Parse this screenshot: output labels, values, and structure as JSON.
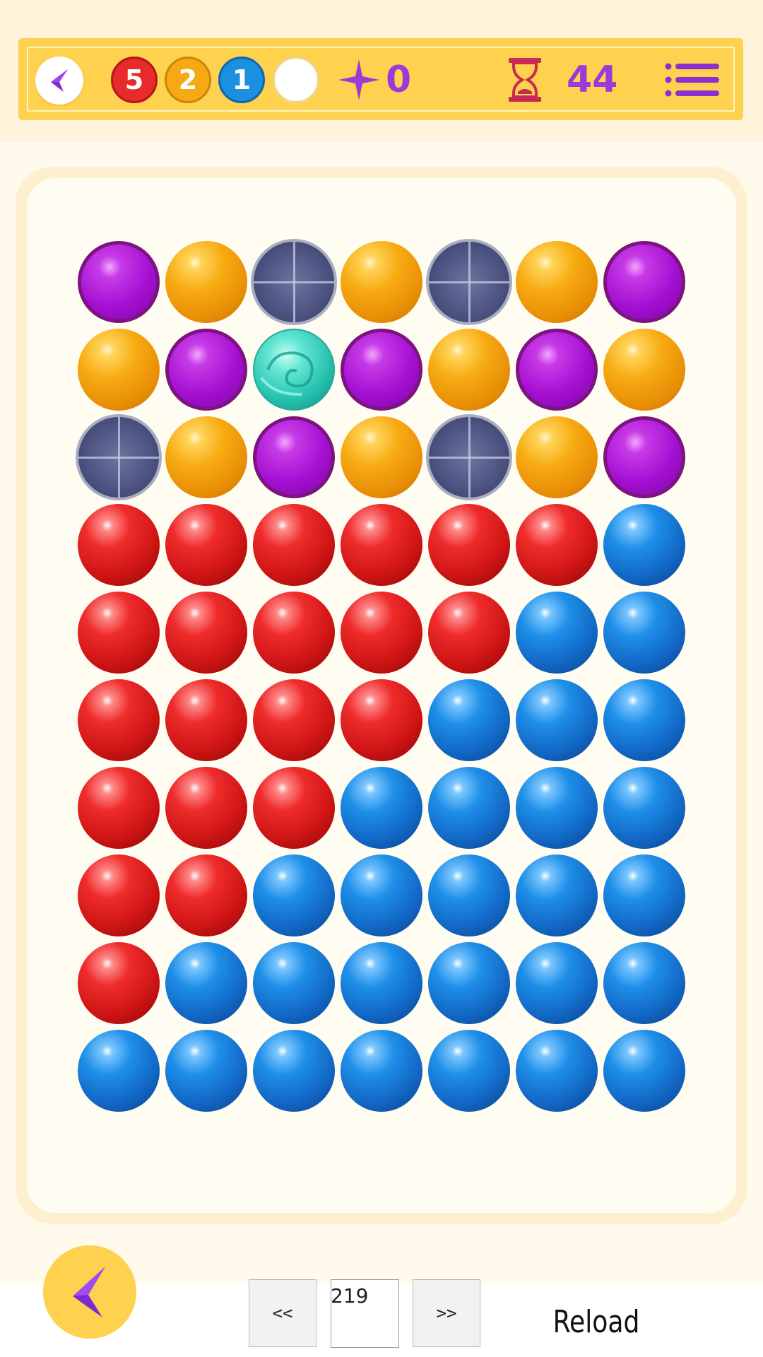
{
  "hud": {
    "back_icon": "chevron-left-icon",
    "counters": [
      {
        "color": "red",
        "value": "5"
      },
      {
        "color": "orange",
        "value": "2"
      },
      {
        "color": "blue",
        "value": "1"
      },
      {
        "color": "white",
        "value": ""
      }
    ],
    "stars": "0",
    "timer_icon": "hourglass-icon",
    "timer": "44",
    "menu_icon": "menu-icon"
  },
  "board": {
    "rows": 10,
    "cols": 7,
    "grid": [
      [
        "purple",
        "orange",
        "block",
        "orange",
        "block",
        "orange",
        "purple"
      ],
      [
        "orange",
        "purple",
        "teal",
        "purple",
        "orange",
        "purple",
        "orange"
      ],
      [
        "block",
        "orange",
        "purple",
        "orange",
        "block",
        "orange",
        "purple"
      ],
      [
        "red",
        "red",
        "red",
        "red",
        "red",
        "red",
        "blue"
      ],
      [
        "red",
        "red",
        "red",
        "red",
        "red",
        "blue",
        "blue"
      ],
      [
        "red",
        "red",
        "red",
        "red",
        "blue",
        "blue",
        "blue"
      ],
      [
        "red",
        "red",
        "red",
        "blue",
        "blue",
        "blue",
        "blue"
      ],
      [
        "red",
        "red",
        "blue",
        "blue",
        "blue",
        "blue",
        "blue"
      ],
      [
        "red",
        "blue",
        "blue",
        "blue",
        "blue",
        "blue",
        "blue"
      ],
      [
        "blue",
        "blue",
        "blue",
        "blue",
        "blue",
        "blue",
        "blue"
      ]
    ]
  },
  "footer": {
    "back_icon": "chevron-left-icon",
    "prev_label": "<<",
    "level_value": "219",
    "next_label": ">>",
    "reload_label": "Reload"
  },
  "colors": {
    "accent_yellow": "#fed14f",
    "counter_purple": "#9b3ad8",
    "background": "#fffaec"
  }
}
